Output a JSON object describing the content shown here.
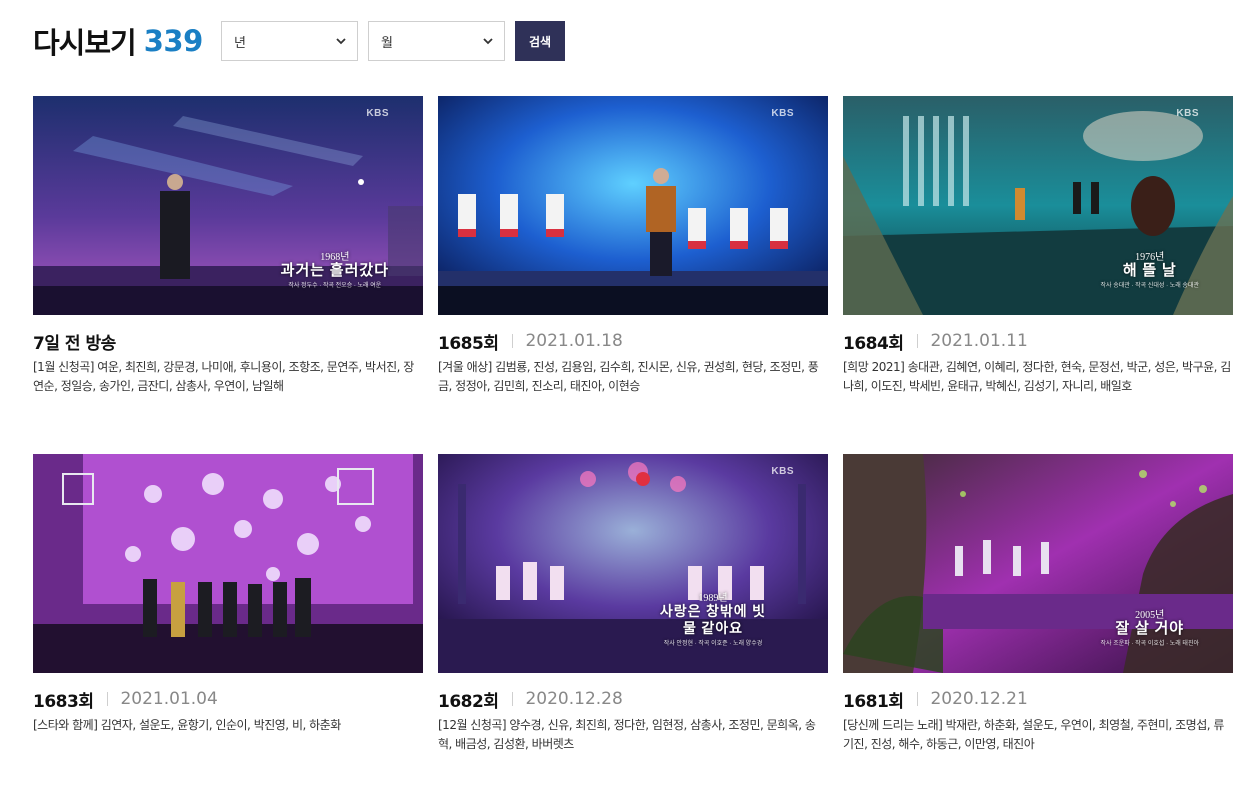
{
  "header": {
    "title": "다시보기",
    "count": "339"
  },
  "filters": {
    "year": {
      "selected": "년"
    },
    "month": {
      "selected": "월"
    },
    "search_label": "검색"
  },
  "colors": {
    "accent": "#1a7fc4",
    "button": "#2f3158"
  },
  "episodes": [
    {
      "episode": "7일 전 방송",
      "date": "",
      "description": "[1월 신청곡] 여운, 최진희, 강문경, 나미애, 후니용이, 조항조, 문연주, 박서진, 장연순, 정일승, 송가인, 금잔디, 삼총사, 우연이, 남일해",
      "thumb": {
        "logo": "KBS",
        "year": "1968년",
        "song": "과거는 흘러갔다",
        "credit": "작사 정두수 · 작곡 전오승 · 노래 여운"
      }
    },
    {
      "episode": "1685회",
      "date": "2021.01.18",
      "description": "[겨울 애상] 김범룡, 진성, 김용임, 김수희, 진시몬, 신유, 권성희, 현당, 조정민, 풍금, 정정아, 김민희, 진소리, 태진아, 이현승",
      "thumb": {
        "logo": "KBS"
      }
    },
    {
      "episode": "1684회",
      "date": "2021.01.11",
      "description": "[희망 2021] 송대관, 김혜연, 이혜리, 정다한, 현숙, 문정선, 박군, 성은, 박구윤, 김나희, 이도진, 박세빈, 윤태규, 박혜신, 김성기, 자니리, 배일호",
      "thumb": {
        "logo": "KBS",
        "year": "1976년",
        "song": "해 뜰 날",
        "credit": "작사 송대관 · 작곡 신대성 · 노래 송대관"
      }
    },
    {
      "episode": "1683회",
      "date": "2021.01.04",
      "description": "[스타와 함께] 김연자, 설운도, 윤항기, 인순이, 박진영, 비, 하춘화",
      "thumb": {}
    },
    {
      "episode": "1682회",
      "date": "2020.12.28",
      "description": "[12월 신청곡] 양수경, 신유, 최진희, 정다한, 임현정, 삼총사, 조정민, 문희옥, 송혁, 배금성, 김성환, 바버렛츠",
      "thumb": {
        "logo": "KBS",
        "year": "1989년",
        "song": "사랑은 창밖에 빗물 같아요",
        "credit": "작사 안정현 · 작곡 이호준 · 노래 양수경"
      }
    },
    {
      "episode": "1681회",
      "date": "2020.12.21",
      "description": "[당신께 드리는 노래] 박재란, 하춘화, 설운도, 우연이, 최영철, 주현미, 조명섭, 류기진, 진성, 해수, 하동근, 이만영, 태진아",
      "thumb": {
        "year": "2005년",
        "song": "잘 살 거야",
        "credit": "작사 조운파 · 작곡 이호섭 · 노래 태진아"
      }
    }
  ]
}
